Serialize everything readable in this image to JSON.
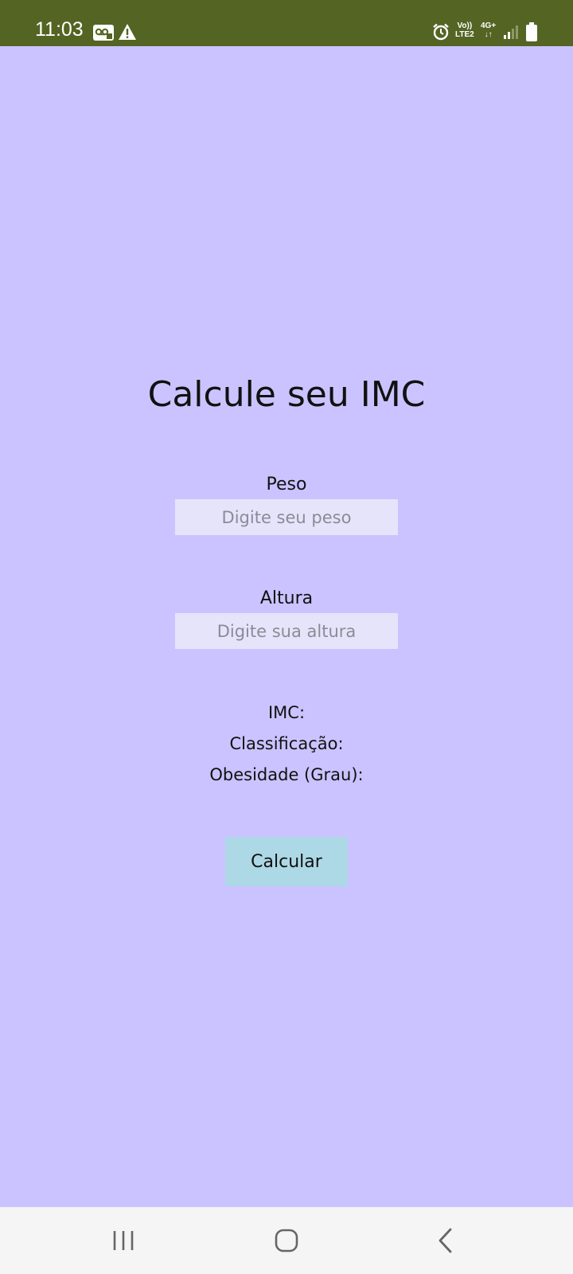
{
  "status_bar": {
    "time": "11:03",
    "icons_left": [
      "voicemail-icon",
      "warning-icon"
    ],
    "icons_right": [
      "alarm-icon",
      "volte-icon",
      "4g-data-icon",
      "signal-icon",
      "battery-icon"
    ],
    "volte_top": "Vo))",
    "volte_bottom": "LTE2",
    "network": "4G+",
    "background_color": "#546423"
  },
  "app": {
    "background_color": "#CBC3FF",
    "title": "Calcule seu IMC"
  },
  "form": {
    "weight": {
      "label": "Peso",
      "placeholder": "Digite seu peso",
      "value": ""
    },
    "height": {
      "label": "Altura",
      "placeholder": "Digite sua altura",
      "value": ""
    }
  },
  "results": {
    "imc_label": "IMC:",
    "classification_label": "Classificação:",
    "obesity_label": "Obesidade (Grau):"
  },
  "actions": {
    "calculate_label": "Calcular",
    "button_color": "#ADD8E6"
  },
  "nav_bar": {
    "buttons": [
      "recent-apps-icon",
      "home-icon",
      "back-icon"
    ]
  }
}
